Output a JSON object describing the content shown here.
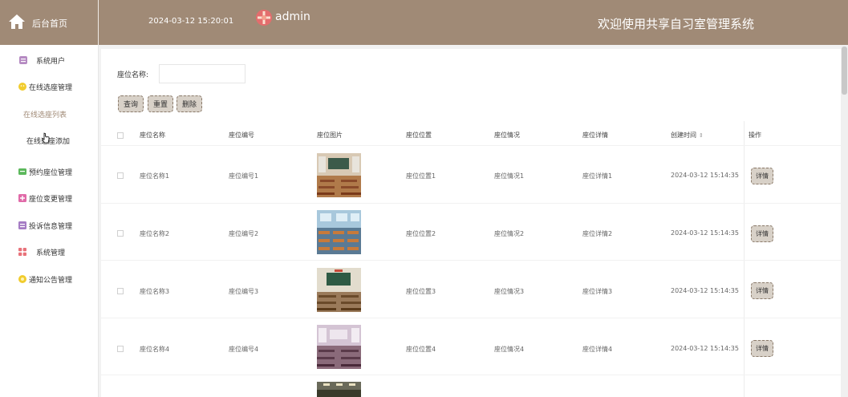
{
  "header": {
    "brand_label": "后台首页",
    "datetime": "2024-03-12 15:20:01",
    "username": "admin",
    "system_title": "欢迎使用共享自习室管理系统",
    "accent_color": "#a08a76"
  },
  "sidebar": {
    "items": [
      {
        "label": "系统用户",
        "icon": "user-group-icon",
        "color": "#b58ac2"
      },
      {
        "label": "在线选座管理",
        "icon": "smile-icon",
        "color": "#f1cc2e"
      },
      {
        "label": "在线选座列表",
        "active": true
      },
      {
        "label": "在线选座添加"
      },
      {
        "label": "预约座位管理",
        "icon": "message-icon",
        "color": "#5cb85c"
      },
      {
        "label": "座位变更管理",
        "icon": "swap-icon",
        "color": "#e06aa8"
      },
      {
        "label": "投诉信息管理",
        "icon": "inbox-icon",
        "color": "#a57cc4"
      },
      {
        "label": "系统管理",
        "icon": "apps-icon",
        "color": "#e8727a"
      },
      {
        "label": "通知公告管理",
        "icon": "bell-icon",
        "color": "#f1cc2e"
      }
    ]
  },
  "filter": {
    "label": "座位名称:",
    "value": "",
    "placeholder": ""
  },
  "actions": {
    "query": "查询",
    "reset": "重置",
    "delete": "删除"
  },
  "table": {
    "columns": [
      "座位名称",
      "座位编号",
      "座位图片",
      "座位位置",
      "座位情况",
      "座位详情",
      "创建时间",
      "操作"
    ],
    "sort_icon": "⇕",
    "detail_label": "详情",
    "rows": [
      {
        "name": "座位名称1",
        "code": "座位编号1",
        "location": "座位位置1",
        "status": "座位情况1",
        "detail": "座位详情1",
        "created": "2024-03-12 15:14:35",
        "image": "classroom-photo-1"
      },
      {
        "name": "座位名称2",
        "code": "座位编号2",
        "location": "座位位置2",
        "status": "座位情况2",
        "detail": "座位详情2",
        "created": "2024-03-12 15:14:35",
        "image": "classroom-photo-2"
      },
      {
        "name": "座位名称3",
        "code": "座位编号3",
        "location": "座位位置3",
        "status": "座位情况3",
        "detail": "座位详情3",
        "created": "2024-03-12 15:14:35",
        "image": "classroom-photo-3"
      },
      {
        "name": "座位名称4",
        "code": "座位编号4",
        "location": "座位位置4",
        "status": "座位情况4",
        "detail": "座位详情4",
        "created": "2024-03-12 15:14:35",
        "image": "classroom-photo-4"
      }
    ]
  }
}
